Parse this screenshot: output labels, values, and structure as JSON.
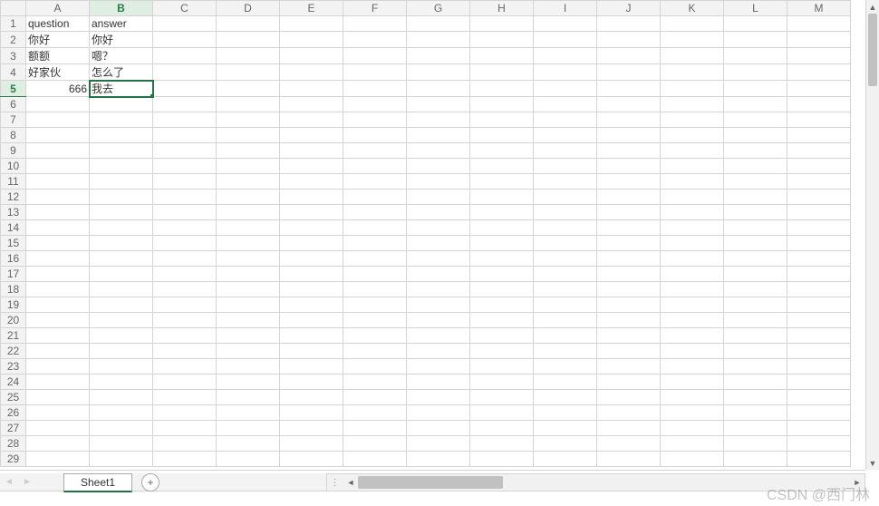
{
  "columns": [
    "A",
    "B",
    "C",
    "D",
    "E",
    "F",
    "G",
    "H",
    "I",
    "J",
    "K",
    "L",
    "M"
  ],
  "visible_rows": 29,
  "active_cell": {
    "row": 5,
    "col": 2
  },
  "cells": {
    "A1": {
      "v": "question",
      "align": "left"
    },
    "B1": {
      "v": "answer",
      "align": "left"
    },
    "A2": {
      "v": "你好",
      "align": "left"
    },
    "B2": {
      "v": "你好",
      "align": "left"
    },
    "A3": {
      "v": "额额",
      "align": "left"
    },
    "B3": {
      "v": "嗯？",
      "align": "left"
    },
    "A4": {
      "v": "好家伙",
      "align": "left"
    },
    "B4": {
      "v": "怎么了",
      "align": "left"
    },
    "A5": {
      "v": "666",
      "align": "right"
    },
    "B5": {
      "v": "我去",
      "align": "left"
    }
  },
  "tabs": {
    "active": "Sheet1"
  },
  "nav": {
    "prev": "◄",
    "next": "►",
    "add": "+"
  },
  "vscroll": {
    "up": "▲",
    "down": "▼"
  },
  "hscroll": {
    "dots": "⋮",
    "left": "◄",
    "right": "►"
  },
  "watermark": "CSDN @西门林"
}
